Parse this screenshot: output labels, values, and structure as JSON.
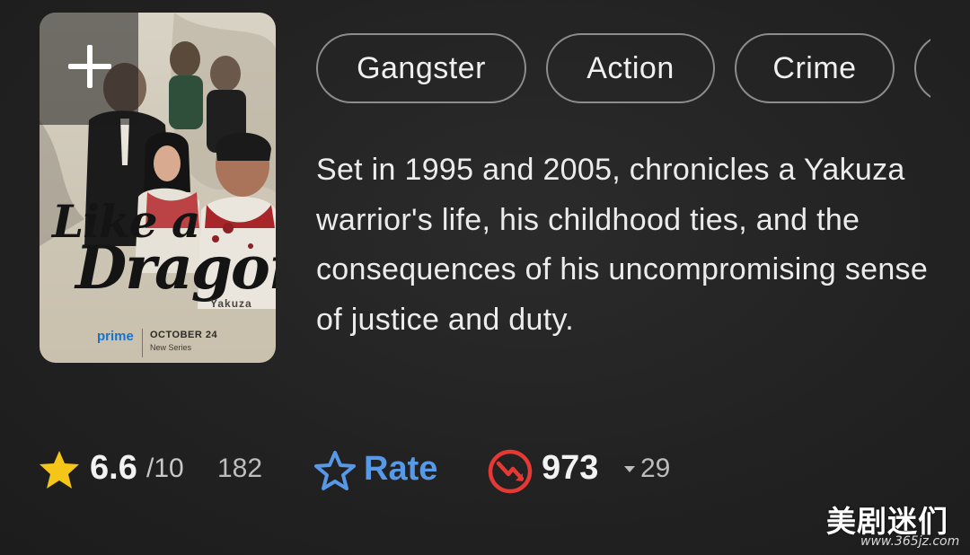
{
  "poster": {
    "title_line1": "Like a",
    "title_line2": "Dragon",
    "subtitle": "Yakuza",
    "network": "prime",
    "release_date": "OCTOBER 24",
    "release_note": "New Series"
  },
  "genres": [
    "Gangster",
    "Action",
    "Crime"
  ],
  "description": "Set in 1995 and 2005, chronicles a Yakuza warrior's life, his childhood ties, and the consequences of his uncompromising sense of justice and duty.",
  "rating": {
    "value": "6.6",
    "max": "/10",
    "count": "182",
    "star_color": "#f5c518"
  },
  "rate_button": {
    "label": "Rate",
    "color": "#5799e6"
  },
  "popularity": {
    "value": "973",
    "change": "29",
    "icon_color": "#e53935"
  },
  "watermark": {
    "title": "美剧迷们",
    "url": "www.365jz.com"
  }
}
